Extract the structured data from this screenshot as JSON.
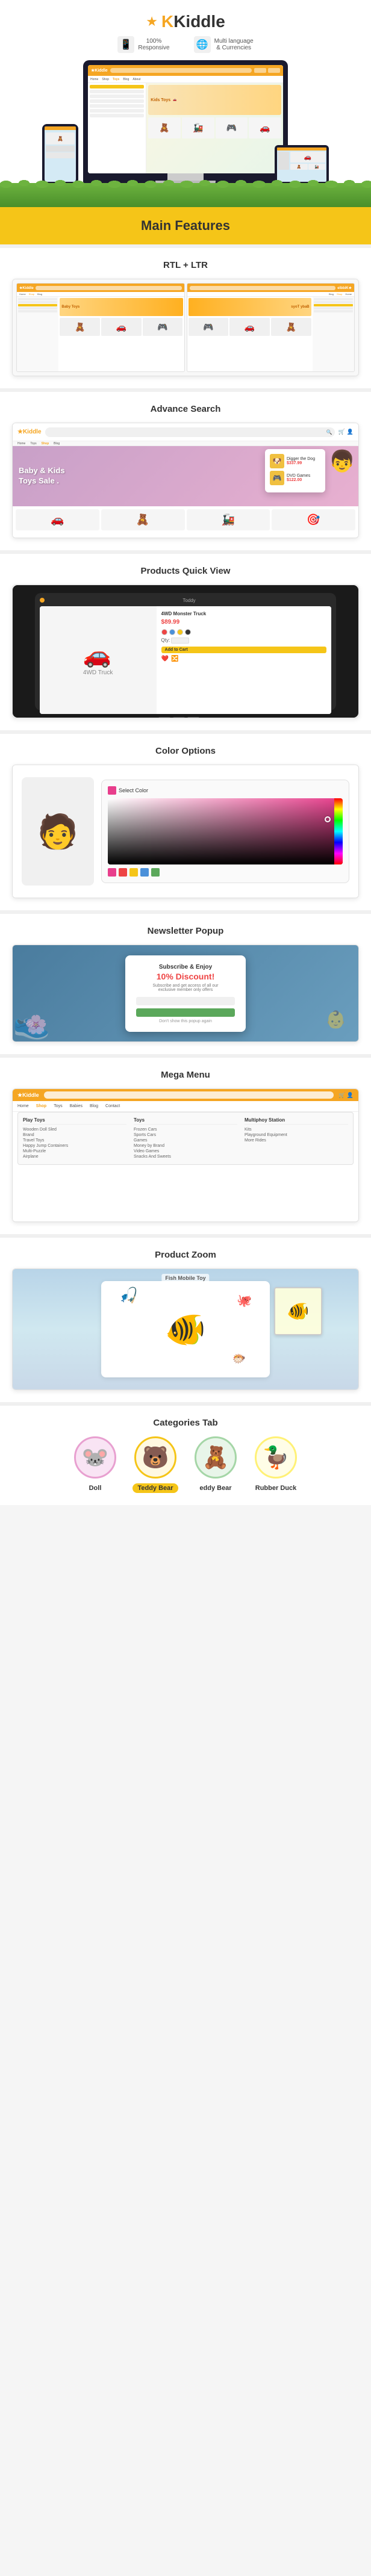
{
  "app": {
    "name": "Kiddle",
    "logo_star": "★",
    "tagline_responsive": "100% Responsive",
    "tagline_multilang": "Multi language & Currencies"
  },
  "badges": [
    {
      "icon": "📱",
      "text": "100%\nResponsive"
    },
    {
      "icon": "🌐",
      "text": "Multi language\n& Currencies"
    }
  ],
  "features_banner": {
    "title": "Main Features"
  },
  "features": [
    {
      "id": "rtl",
      "title": "RTL + LTR"
    },
    {
      "id": "search",
      "title": "Advance Search"
    },
    {
      "id": "quickview",
      "title": "Products Quick View"
    },
    {
      "id": "color",
      "title": "Color Options"
    },
    {
      "id": "newsletter",
      "title": "Newsletter Popup",
      "discount": "10% Discount!",
      "subscribe_title": "Subscribe & Enjoy",
      "subscribe_sub": "Subscribe and get access of all our\nexclusive member only offers",
      "check_text": "Don't show this popup again"
    },
    {
      "id": "megamenu",
      "title": "Mega Menu",
      "columns": [
        {
          "heading": "Play Toys",
          "items": [
            "Wooden Doll Sled",
            "Brand",
            "Travel Toys",
            "Happy Jump Containers",
            "Multi-Puzzle",
            "Airplane"
          ]
        },
        {
          "heading": "Toys",
          "items": [
            "Frozen Cars",
            "Sports Cars",
            "Games",
            "Money by Brand",
            "Video Games",
            "Snacks And Sweets"
          ]
        },
        {
          "heading": "Multiphoy Station",
          "items": [
            "Kits",
            "Playground Equipment",
            "More Rides"
          ]
        }
      ]
    },
    {
      "id": "zoom",
      "title": "Product Zoom"
    },
    {
      "id": "categories",
      "title": "Categories Tab"
    }
  ],
  "categories": [
    {
      "emoji": "🐭",
      "label": "Doll",
      "active": false
    },
    {
      "emoji": "🐻",
      "label": "Teddy Bear",
      "active": true
    },
    {
      "emoji": "🧸",
      "label": "eddy Bear",
      "active": false
    },
    {
      "emoji": "🦆",
      "label": "Rubber Duck",
      "active": false
    }
  ],
  "search_hero": {
    "text": "Baby & Kids\nToys Sale ."
  },
  "search_popup_items": [
    {
      "price": "$337.99",
      "name": "Digger the Dog"
    },
    {
      "price": "$122.00",
      "name": "DVD Games"
    }
  ],
  "color_picker": {
    "label": "Select Color"
  },
  "newsletter": {
    "title": "Subscribe & Enjoy",
    "discount": "10% Discount!",
    "check": "Don't show this popup again"
  },
  "monitor_preview": {
    "toy_emoji": "🚗"
  }
}
